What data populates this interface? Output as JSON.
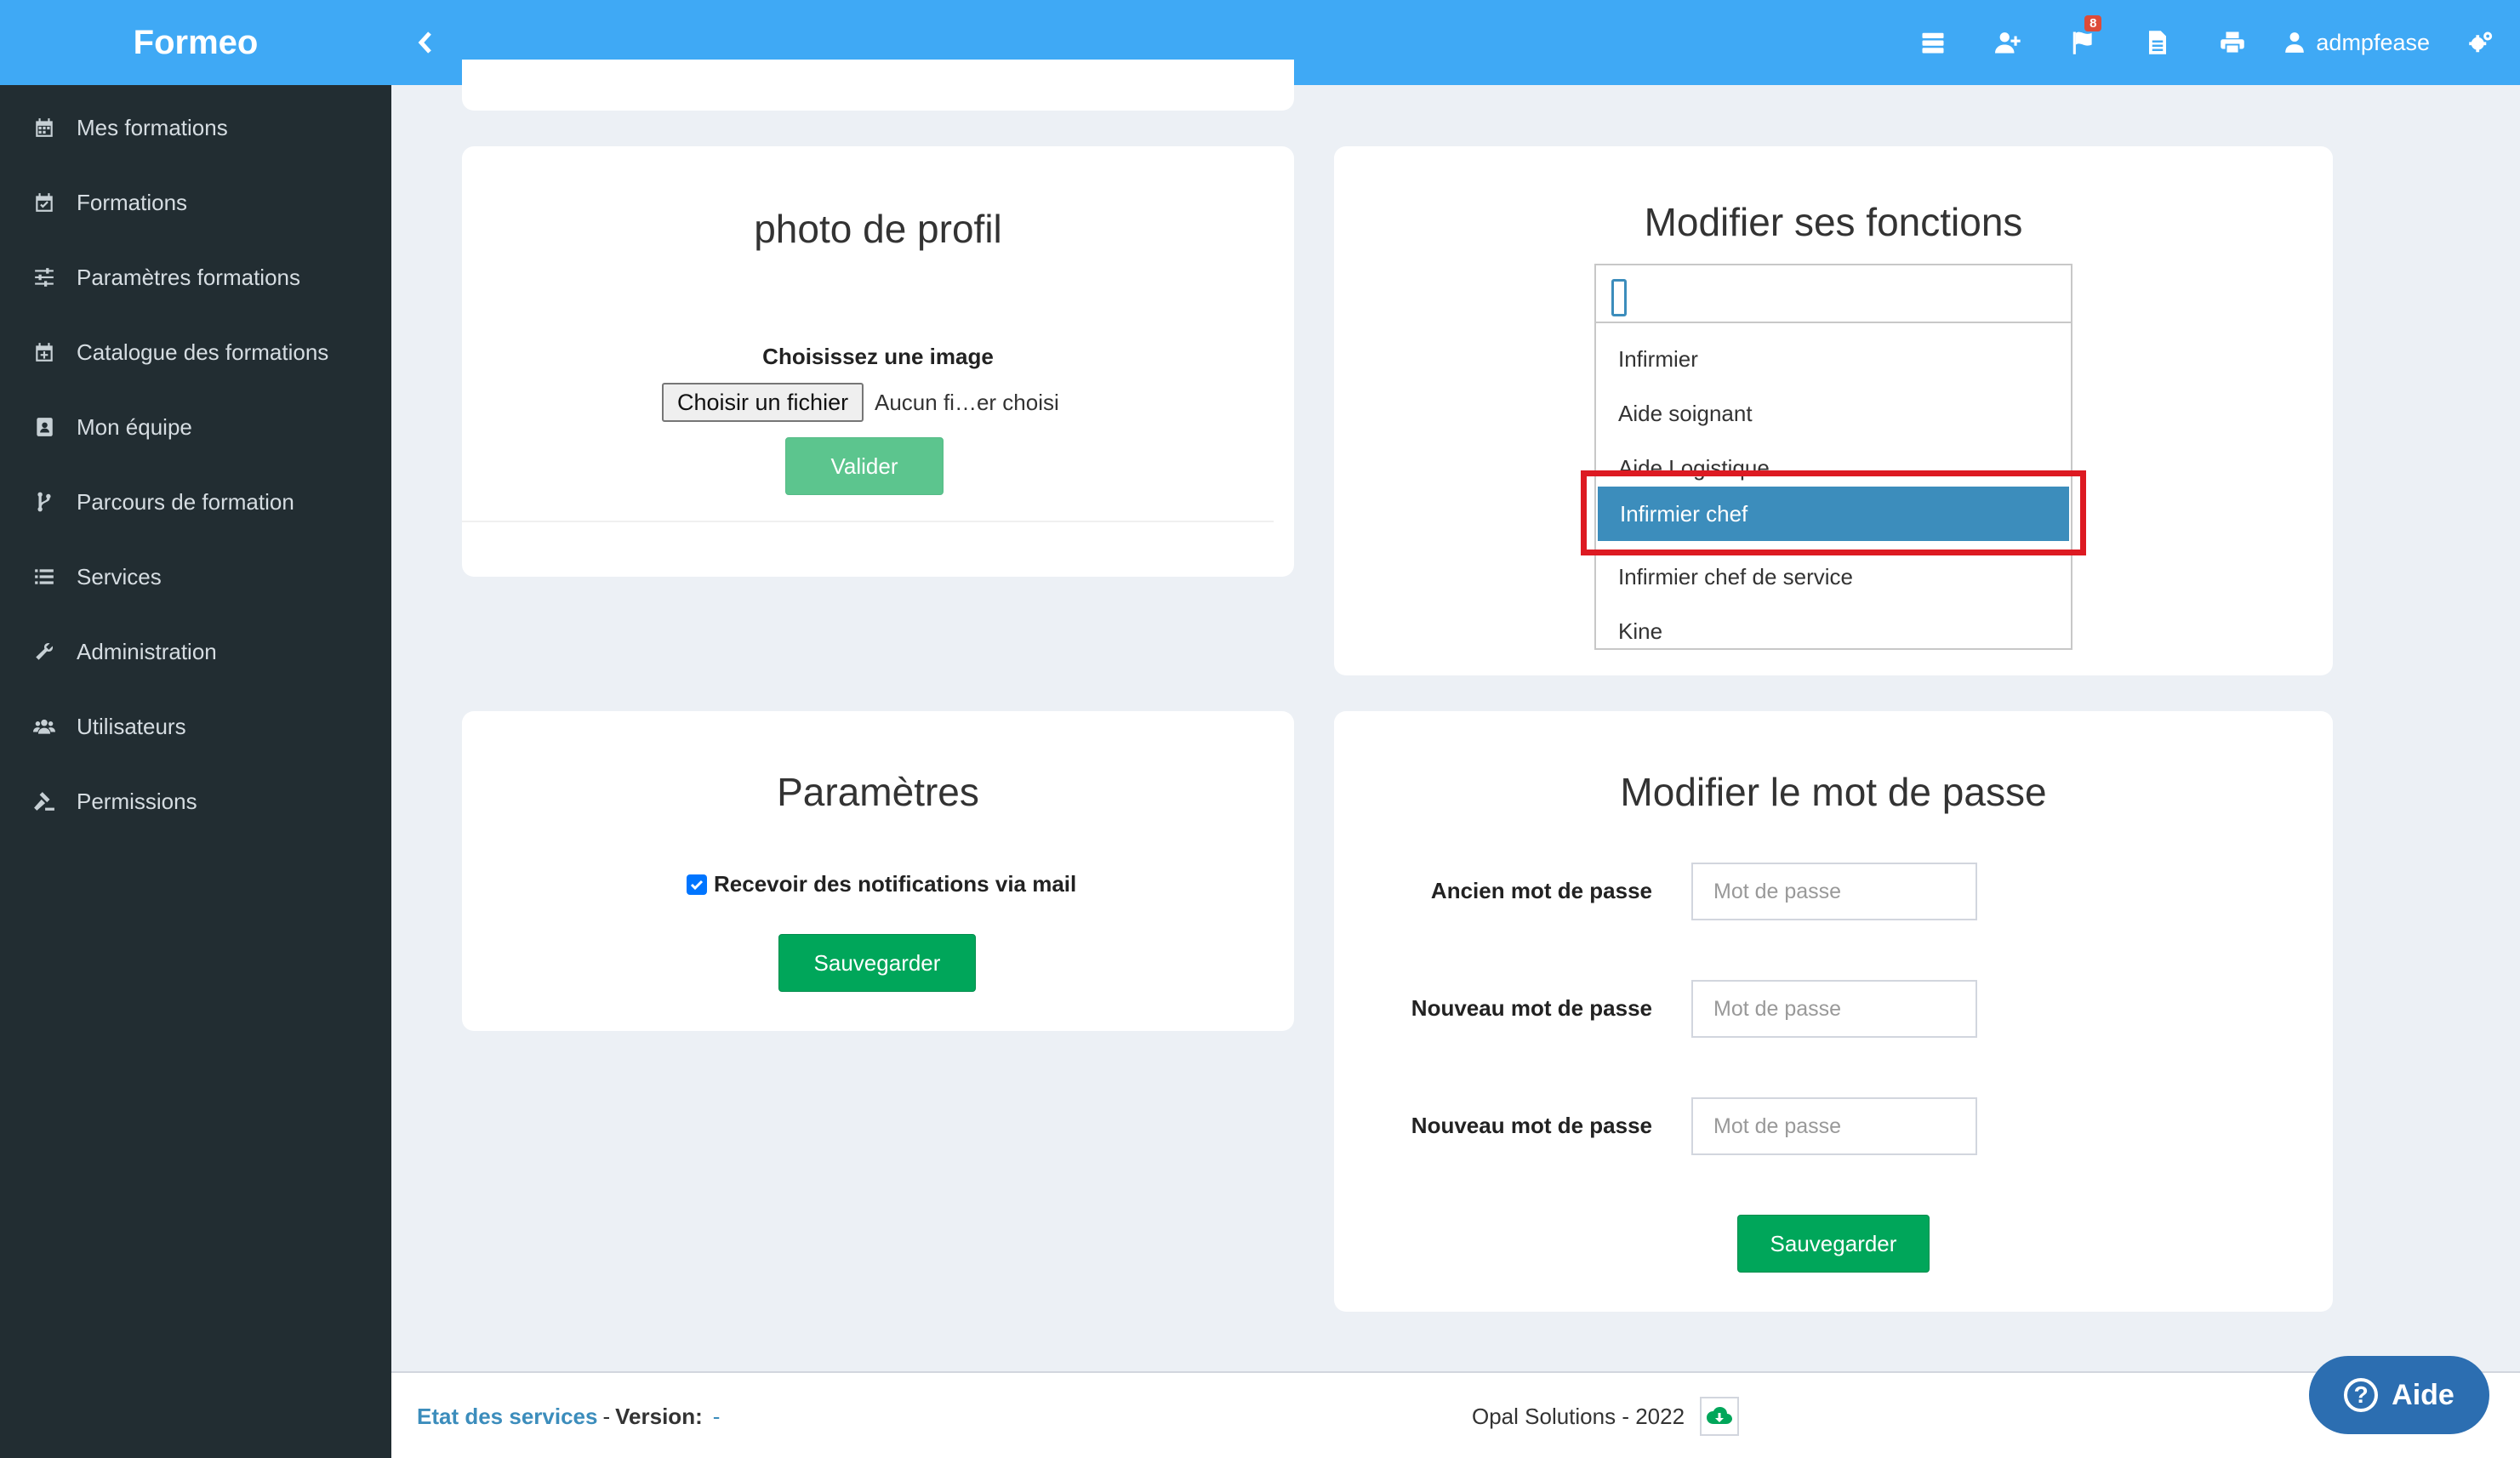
{
  "brand": "Formeo",
  "sidebar": {
    "items": [
      {
        "label": "Mes formations",
        "icon": "calendar-icon"
      },
      {
        "label": "Formations",
        "icon": "calendar-check-icon"
      },
      {
        "label": "Paramètres formations",
        "icon": "sliders-icon"
      },
      {
        "label": "Catalogue des formations",
        "icon": "calendar-plus-icon"
      },
      {
        "label": "Mon équipe",
        "icon": "contact-book-icon"
      },
      {
        "label": "Parcours de formation",
        "icon": "code-branch-icon"
      },
      {
        "label": "Services",
        "icon": "list-icon"
      },
      {
        "label": "Administration",
        "icon": "wrench-icon"
      },
      {
        "label": "Utilisateurs",
        "icon": "users-icon"
      },
      {
        "label": "Permissions",
        "icon": "gavel-icon"
      }
    ]
  },
  "topbar": {
    "notification_count": "8",
    "username": "admpfease"
  },
  "photo": {
    "title": "photo de profil",
    "choose_label": "Choisissez une image",
    "file_button": "Choisir un fichier",
    "file_status": "Aucun fi…er choisi",
    "submit": "Valider"
  },
  "fonctions": {
    "title": "Modifier ses fonctions",
    "options": [
      "Infirmier",
      "Aide soignant",
      "Aide Logistique",
      "Infirmier chef",
      "Infirmier chef de service",
      "Kine"
    ],
    "selected": "Infirmier chef"
  },
  "parametres": {
    "title": "Paramètres",
    "checkbox_label": "Recevoir des notifications via mail",
    "save": "Sauvegarder"
  },
  "password": {
    "title": "Modifier le mot de passe",
    "fields": [
      {
        "label": "Ancien mot de passe",
        "placeholder": "Mot de passe"
      },
      {
        "label": "Nouveau mot de passe",
        "placeholder": "Mot de passe"
      },
      {
        "label": "Nouveau mot de passe",
        "placeholder": "Mot de passe"
      }
    ],
    "save": "Sauvegarder"
  },
  "footer": {
    "status_link": "Etat des services",
    "version_label": "Version:",
    "version_value": "-",
    "copyright": "Opal Solutions - 2022"
  },
  "help": {
    "label": "Aide"
  },
  "colors": {
    "topbar": "#3fa9f5",
    "sidebar": "#222d32",
    "accent_green": "#00a65a",
    "selected_option": "#3c8dbc",
    "highlight": "#dd1a22"
  }
}
